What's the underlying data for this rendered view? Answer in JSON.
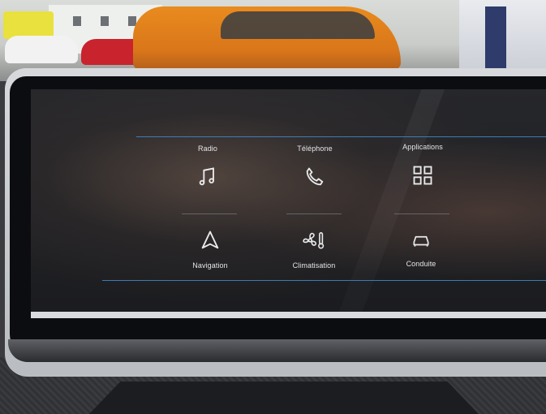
{
  "menu": {
    "tiles": [
      {
        "id": "radio",
        "label": "Radio",
        "icon": "music-note-icon"
      },
      {
        "id": "telephone",
        "label": "Téléphone",
        "icon": "phone-icon"
      },
      {
        "id": "applications",
        "label": "Applications",
        "icon": "grid-icon"
      },
      {
        "id": "navigation",
        "label": "Navigation",
        "icon": "navigation-arrow-icon"
      },
      {
        "id": "climatisation",
        "label": "Climatisation",
        "icon": "fan-thermometer-icon"
      },
      {
        "id": "conduite",
        "label": "Conduite",
        "icon": "car-icon"
      }
    ]
  },
  "colors": {
    "accent_line": "#3d86c6",
    "icon": "#e9eaec",
    "screen_bg": "#1f2023"
  }
}
